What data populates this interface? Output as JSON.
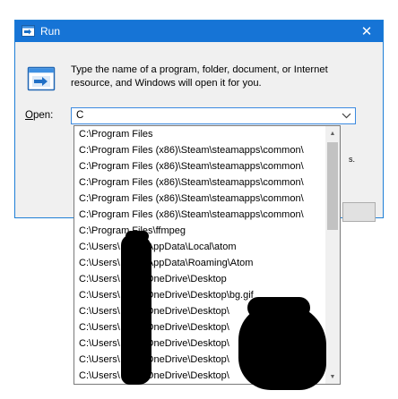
{
  "window": {
    "title": "Run",
    "close_glyph": "✕",
    "description": "Type the name of a program, folder, document, or Internet resource, and Windows will open it for you.",
    "open_label_underlined": "O",
    "open_label_rest": "pen:",
    "open_value": "C",
    "partial_text": "s.",
    "icons": {
      "app": "run-icon",
      "close": "close-icon",
      "combo_arrow": "chevron-down-icon"
    }
  },
  "dropdown": {
    "items": [
      "C:\\Program Files",
      "C:\\Program Files (x86)\\Steam\\steamapps\\common\\",
      "C:\\Program Files (x86)\\Steam\\steamapps\\common\\",
      "C:\\Program Files (x86)\\Steam\\steamapps\\common\\",
      "C:\\Program Files (x86)\\Steam\\steamapps\\common\\",
      "C:\\Program Files (x86)\\Steam\\steamapps\\common\\",
      "C:\\Program Files\\ffmpeg",
      "C:\\Users\\",
      "C:\\Users\\",
      "C:\\Users\\",
      "C:\\Users\\",
      "C:\\Users\\",
      "C:\\Users\\",
      "C:\\Users\\",
      "C:\\Users\\",
      "C:\\Users\\"
    ],
    "item_suffixes": [
      "",
      "",
      "",
      "",
      "",
      "",
      "",
      "AppData\\Local\\atom",
      "AppData\\Roaming\\Atom",
      "\\OneDrive\\Desktop",
      "\\OneDrive\\Desktop\\bg.gif",
      "\\OneDrive\\Desktop\\",
      "\\OneDrive\\Desktop\\",
      "\\OneDrive\\Desktop\\",
      "\\OneDrive\\Desktop\\",
      "\\OneDrive\\Desktop\\"
    ],
    "scroll_up_glyph": "▲",
    "scroll_down_glyph": "▼"
  },
  "colors": {
    "title_bar": "#1674d6",
    "window_border": "#1e7fd6",
    "dialog_bg": "#f0f0f0",
    "combo_border": "#3c8ae0",
    "redaction": "#000000"
  }
}
